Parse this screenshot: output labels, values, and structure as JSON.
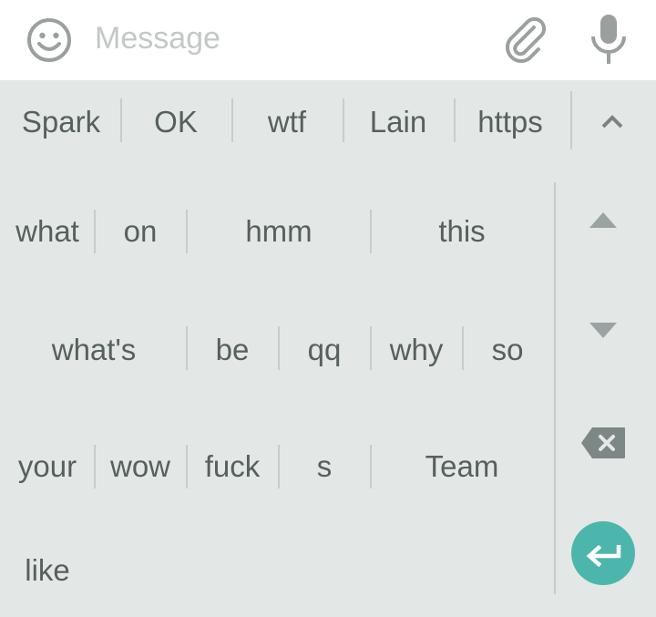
{
  "message_bar": {
    "placeholder": "Message",
    "icons": [
      "smiley-icon",
      "paperclip-icon",
      "microphone-icon"
    ]
  },
  "suggestions": [
    "Spark",
    "OK",
    "wtf",
    "Lain",
    "https"
  ],
  "word_grid": {
    "row1": [
      "what",
      "on",
      "hmm",
      "this"
    ],
    "row2": [
      "what's",
      "be",
      "qq",
      "why",
      "so"
    ],
    "row3": [
      "your",
      "wow",
      "fuck",
      "s",
      "Team"
    ],
    "row4": [
      "like"
    ]
  },
  "side_controls": [
    "chevron-up-icon",
    "arrow-up-icon",
    "arrow-down-icon",
    "backspace-icon",
    "enter-icon"
  ],
  "colors": {
    "keyboard_bg": "#e3e8e6",
    "text": "#56605e",
    "accent": "#4db6ac",
    "icon": "#8a9290"
  }
}
